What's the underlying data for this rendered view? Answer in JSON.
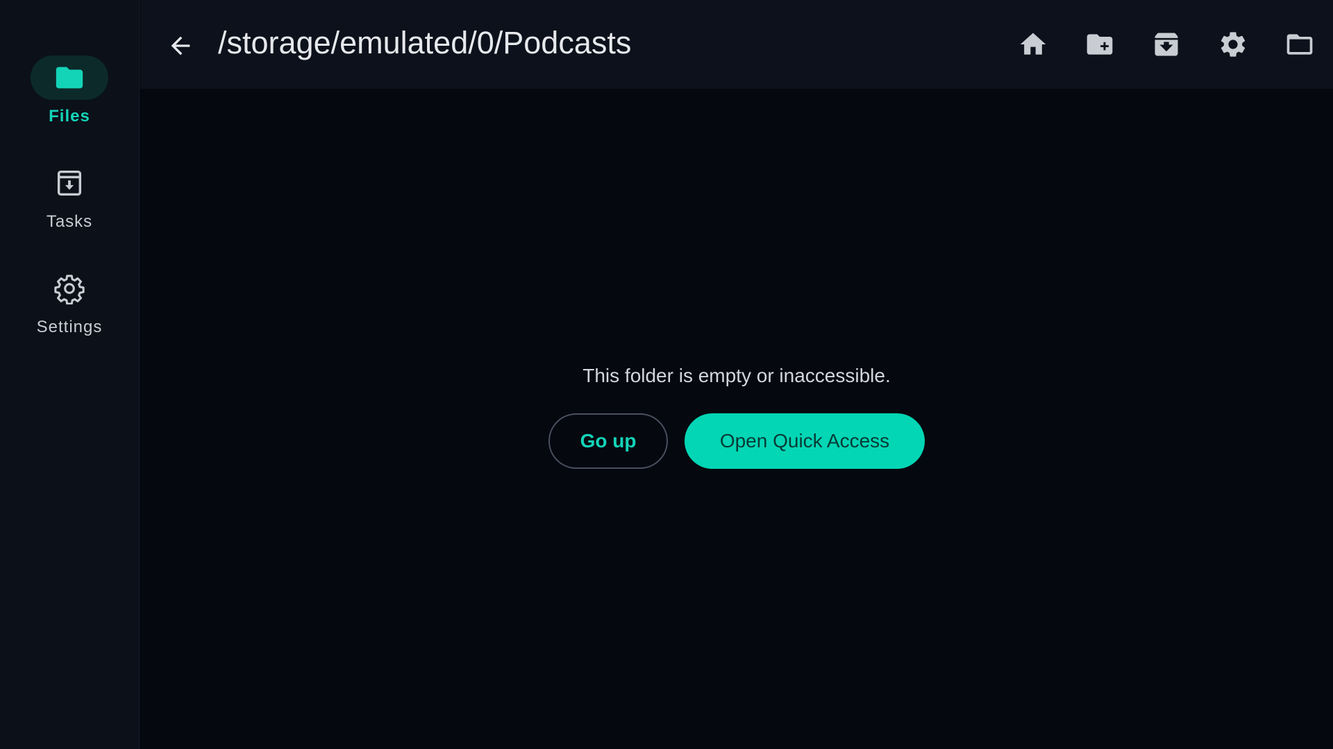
{
  "theme": {
    "accent": "#02d6b5",
    "accent_text": "#14d4b8",
    "background": "#05080f",
    "sidebar_bg": "#0b1019",
    "header_bg": "#0c111b"
  },
  "sidebar": {
    "items": [
      {
        "label": "Files",
        "icon": "folder-icon",
        "active": true
      },
      {
        "label": "Tasks",
        "icon": "archive-download-icon",
        "active": false
      },
      {
        "label": "Settings",
        "icon": "gear-outline-icon",
        "active": false
      }
    ]
  },
  "header": {
    "path": "/storage/emulated/0/Podcasts",
    "actions": [
      {
        "name": "home",
        "icon": "home-icon"
      },
      {
        "name": "new-folder",
        "icon": "folder-plus-icon"
      },
      {
        "name": "archive",
        "icon": "archive-download-icon"
      },
      {
        "name": "settings",
        "icon": "gear-icon"
      },
      {
        "name": "folder",
        "icon": "folder-outline-icon"
      }
    ]
  },
  "main": {
    "empty_message": "This folder is empty or inaccessible.",
    "go_up_label": "Go up",
    "quick_access_label": "Open Quick Access"
  }
}
